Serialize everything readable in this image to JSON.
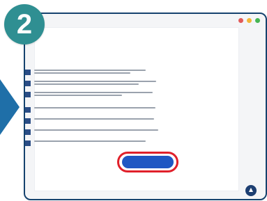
{
  "step": {
    "number": "2"
  },
  "window": {
    "traffic_colors": [
      "#e25a58",
      "#f2b739",
      "#45b553"
    ]
  },
  "document": {
    "heading": "",
    "intro": "",
    "items": [
      {
        "lines": [
          "",
          ""
        ]
      },
      {
        "lines": [
          "",
          ""
        ]
      },
      {
        "lines": [
          "",
          ""
        ]
      },
      {
        "lines": [
          ""
        ]
      },
      {
        "lines": [
          ""
        ]
      },
      {
        "lines": [
          ""
        ]
      },
      {
        "lines": [
          ""
        ]
      }
    ]
  },
  "cta": {
    "label": ""
  },
  "footer": {
    "text": ""
  },
  "colors": {
    "badge": "#2f8f92",
    "frame_border": "#15426e",
    "bullet": "#2a4d86",
    "cta": "#1f57c3",
    "highlight_ring": "#e0202a",
    "fab": "#1d3f72"
  },
  "icons": {
    "arrow": "left-arrow",
    "scroll": "up-chevron-icon"
  }
}
